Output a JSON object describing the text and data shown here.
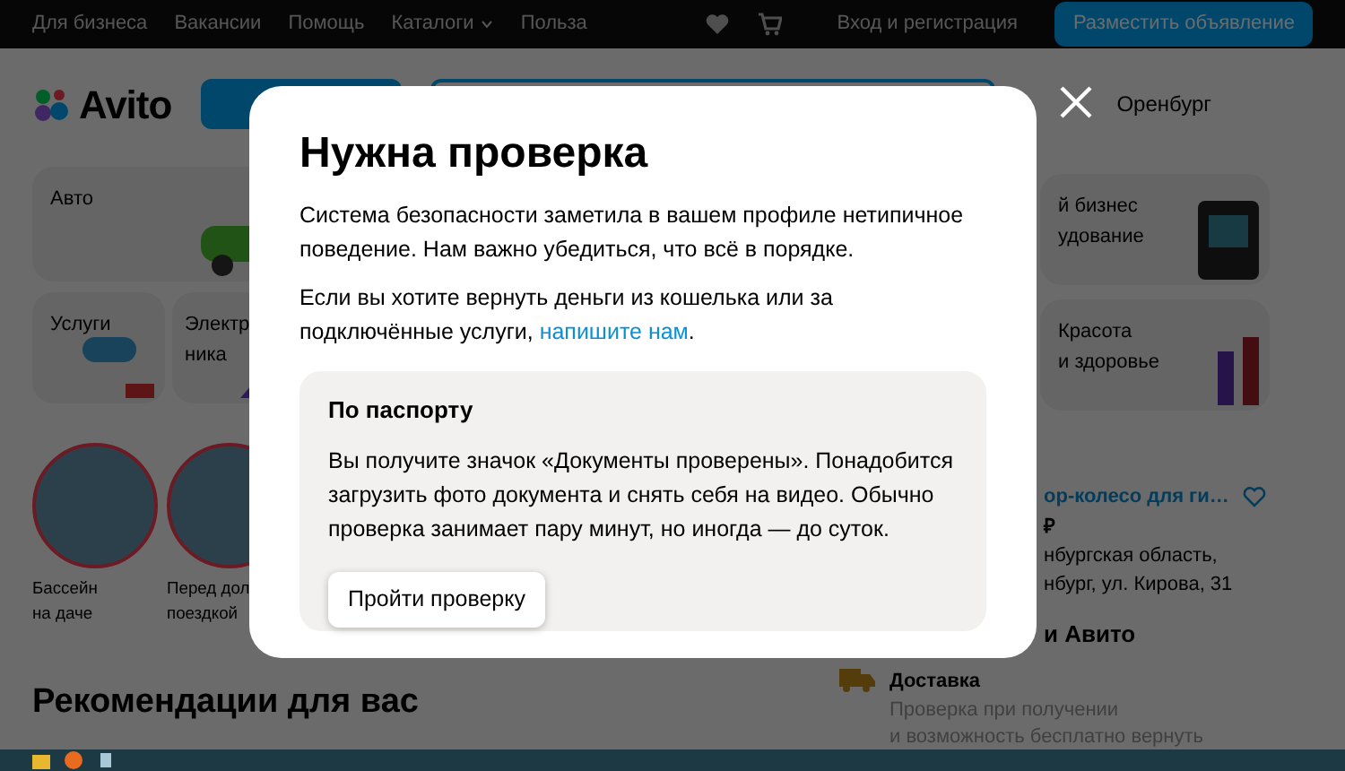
{
  "top_bar": {
    "links": [
      {
        "label": "Для бизнеса",
        "dropdown": false
      },
      {
        "label": "Вакансии",
        "dropdown": false
      },
      {
        "label": "Помощь",
        "dropdown": false
      },
      {
        "label": "Каталоги",
        "dropdown": true
      },
      {
        "label": "Польза",
        "dropdown": false
      }
    ],
    "login": "Вход и регистрация",
    "post_button": "Разместить объявление"
  },
  "header": {
    "logo": "Avito",
    "city": "Оренбург"
  },
  "categories_left": [
    {
      "lines": [
        "Авто"
      ],
      "kind": "car"
    },
    {
      "lines": [
        "Услуги"
      ],
      "kind": "roller"
    },
    {
      "lines": [
        "Электр",
        "ника"
      ],
      "kind": "shape"
    }
  ],
  "stories": [
    {
      "lines": [
        "Бассейн",
        "на даче"
      ]
    },
    {
      "lines": [
        "Перед дол",
        "поездкой"
      ]
    }
  ],
  "recommendations_title": "Рекомендации для вас",
  "categories_right": [
    {
      "lines": [
        "й бизнес",
        "удование"
      ],
      "kind": "terminal"
    },
    {
      "lines": [
        "Красота",
        "и здоровье"
      ],
      "kind": "cosmetics"
    }
  ],
  "product": {
    "title": "ор-колесо для ги…",
    "price": "₽",
    "address": [
      "нбургская область,",
      "нбург, ул. Кирова, 31"
    ],
    "favorite": false
  },
  "avito_section": {
    "title": "и Авито",
    "feature_title": "Доставка",
    "feature_text": [
      "Проверка при получении",
      "и возможность бесплатно вернуть"
    ]
  },
  "modal": {
    "title": "Нужна проверка",
    "paragraphs": [
      "Система безопасности заметила в вашем профиле нетипичное поведение. Нам важно убедиться, что всё в порядке."
    ],
    "refund_text": "Если вы хотите вернуть деньги из кошелька или за подключённые услуги, ",
    "refund_link": "напишите нам",
    "refund_end": ".",
    "option": {
      "title": "По паспорту",
      "text": "Вы получите значок «Документы проверены». Понадобится загрузить фото документа и снять себя на видео. Обычно проверка занимает пару минут, но иногда — до суток.",
      "button": "Пройти проверку"
    }
  }
}
